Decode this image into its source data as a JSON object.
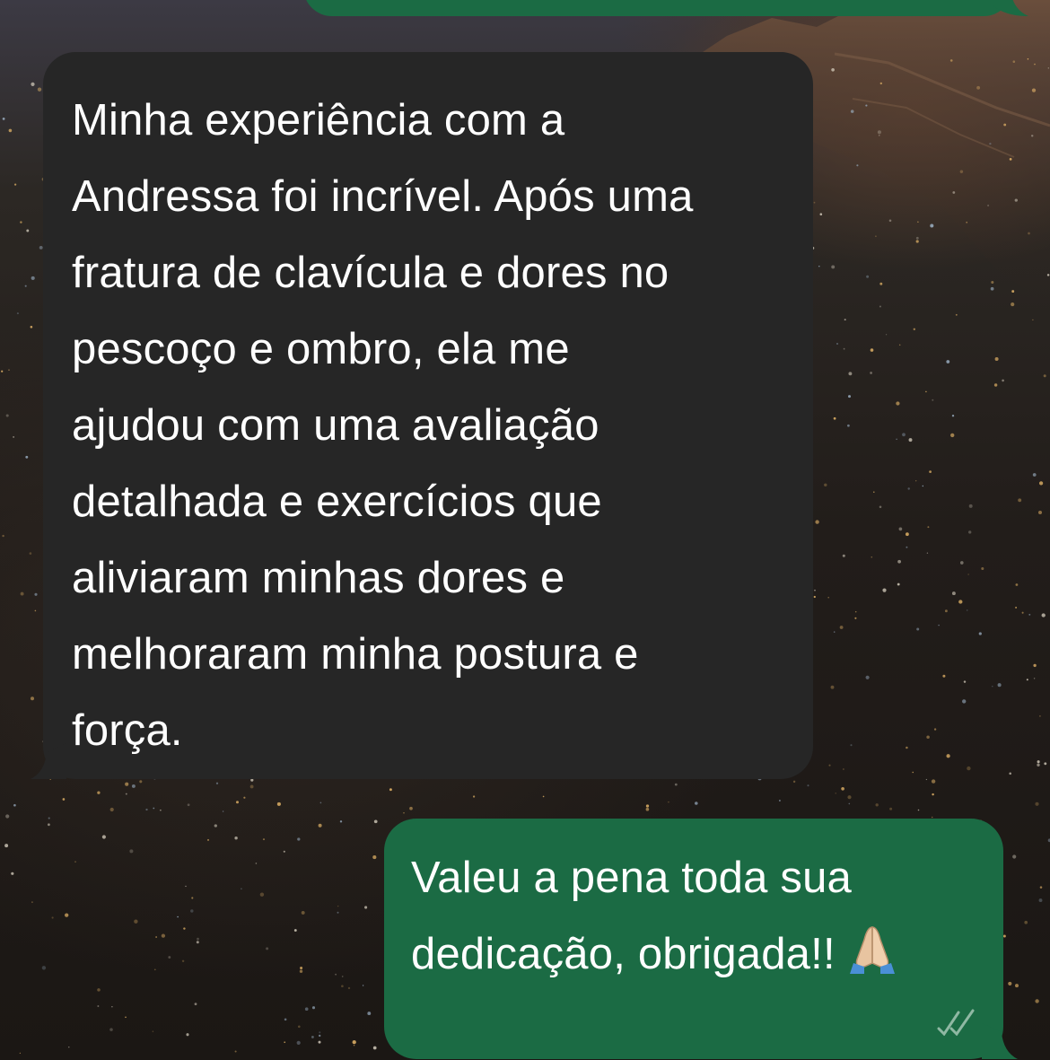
{
  "chat": {
    "previous_outgoing_text": "",
    "incoming": {
      "text": "Minha experiência com a\nAndressa foi incrível. Após uma\nfratura de clavícula e dores no\npescoço e ombro, ela me\najudou com uma avaliação\ndetalhada e exercícios que\naliviaram minhas dores e\nmelhoraram minha postura e\nforça."
    },
    "outgoing": {
      "text": "Valeu a pena toda sua\ndedicação, obrigada!!",
      "emoji": "folded-hands-emoji",
      "status": "read-ticks-icon"
    }
  },
  "colors": {
    "incoming_bubble": "#262626",
    "outgoing_bubble": "#1b6b44",
    "text": "#ffffff"
  }
}
